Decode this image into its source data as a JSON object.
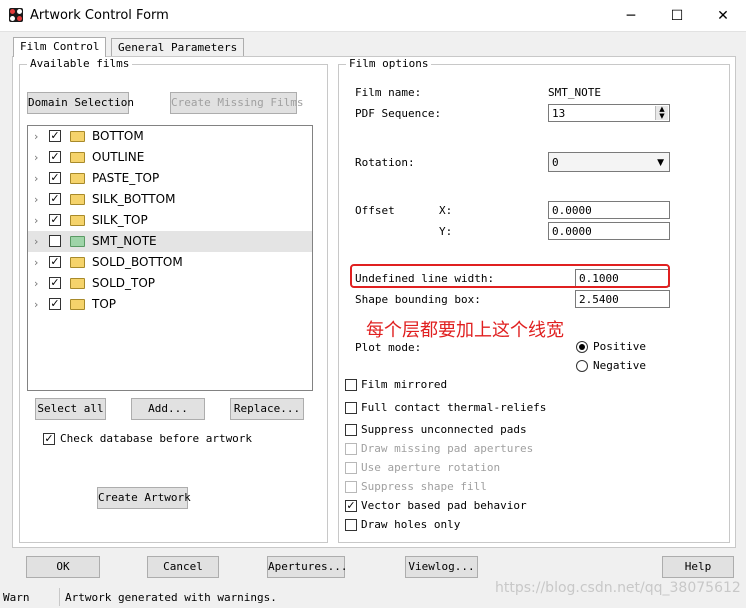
{
  "window": {
    "title": "Artwork Control Form",
    "minimize": "─",
    "maximize": "☐",
    "close": "✕"
  },
  "tabs": [
    {
      "label": "Film Control",
      "active": true
    },
    {
      "label": "General Parameters",
      "active": false
    }
  ],
  "available_films": {
    "title": "Available films",
    "domain_selection": "Domain Selection",
    "create_missing": "Create Missing Films",
    "films": [
      {
        "name": "BOTTOM",
        "checked": true
      },
      {
        "name": "OUTLINE",
        "checked": true
      },
      {
        "name": "PASTE_TOP",
        "checked": true
      },
      {
        "name": "SILK_BOTTOM",
        "checked": true
      },
      {
        "name": "SILK_TOP",
        "checked": true
      },
      {
        "name": "SMT_NOTE",
        "checked": false,
        "selected": true
      },
      {
        "name": "SOLD_BOTTOM",
        "checked": true
      },
      {
        "name": "SOLD_TOP",
        "checked": true
      },
      {
        "name": "TOP",
        "checked": true
      }
    ],
    "select_all": "Select all",
    "add": "Add...",
    "replace": "Replace...",
    "check_database": "Check database before artwork",
    "check_database_checked": true,
    "create_artwork": "Create Artwork"
  },
  "film_options": {
    "title": "Film options",
    "film_name_label": "Film name:",
    "film_name_value": "SMT_NOTE",
    "pdf_sequence_label": "PDF Sequence:",
    "pdf_sequence_value": "13",
    "rotation_label": "Rotation:",
    "rotation_value": "0",
    "offset_label": "Offset",
    "x_label": "X:",
    "x_value": "0.0000",
    "y_label": "Y:",
    "y_value": "0.0000",
    "undefined_line_width_label": "Undefined line width:",
    "undefined_line_width_value": "0.1000",
    "shape_bounding_box_label": "Shape bounding box:",
    "shape_bounding_box_value": "2.5400",
    "annotation": "每个层都要加上这个线宽",
    "plot_mode_label": "Plot mode:",
    "positive": "Positive",
    "negative": "Negative",
    "plot_mode_selected": "Positive",
    "checkboxes": [
      {
        "label": "Film mirrored",
        "checked": false,
        "enabled": true
      },
      {
        "label": "Full contact thermal-reliefs",
        "checked": false,
        "enabled": true
      },
      {
        "label": "Suppress unconnected pads",
        "checked": false,
        "enabled": true
      },
      {
        "label": "Draw missing pad apertures",
        "checked": false,
        "enabled": false
      },
      {
        "label": "Use aperture rotation",
        "checked": false,
        "enabled": false
      },
      {
        "label": "Suppress shape fill",
        "checked": false,
        "enabled": false
      },
      {
        "label": "Vector based pad behavior",
        "checked": true,
        "enabled": true
      },
      {
        "label": "Draw holes only",
        "checked": false,
        "enabled": true
      }
    ]
  },
  "footer_buttons": {
    "ok": "OK",
    "cancel": "Cancel",
    "apertures": "Apertures...",
    "viewlog": "Viewlog...",
    "help": "Help"
  },
  "status": {
    "level": "Warn",
    "message": "Artwork generated with warnings."
  },
  "watermark": "https://blog.csdn.net/qq_38075612"
}
